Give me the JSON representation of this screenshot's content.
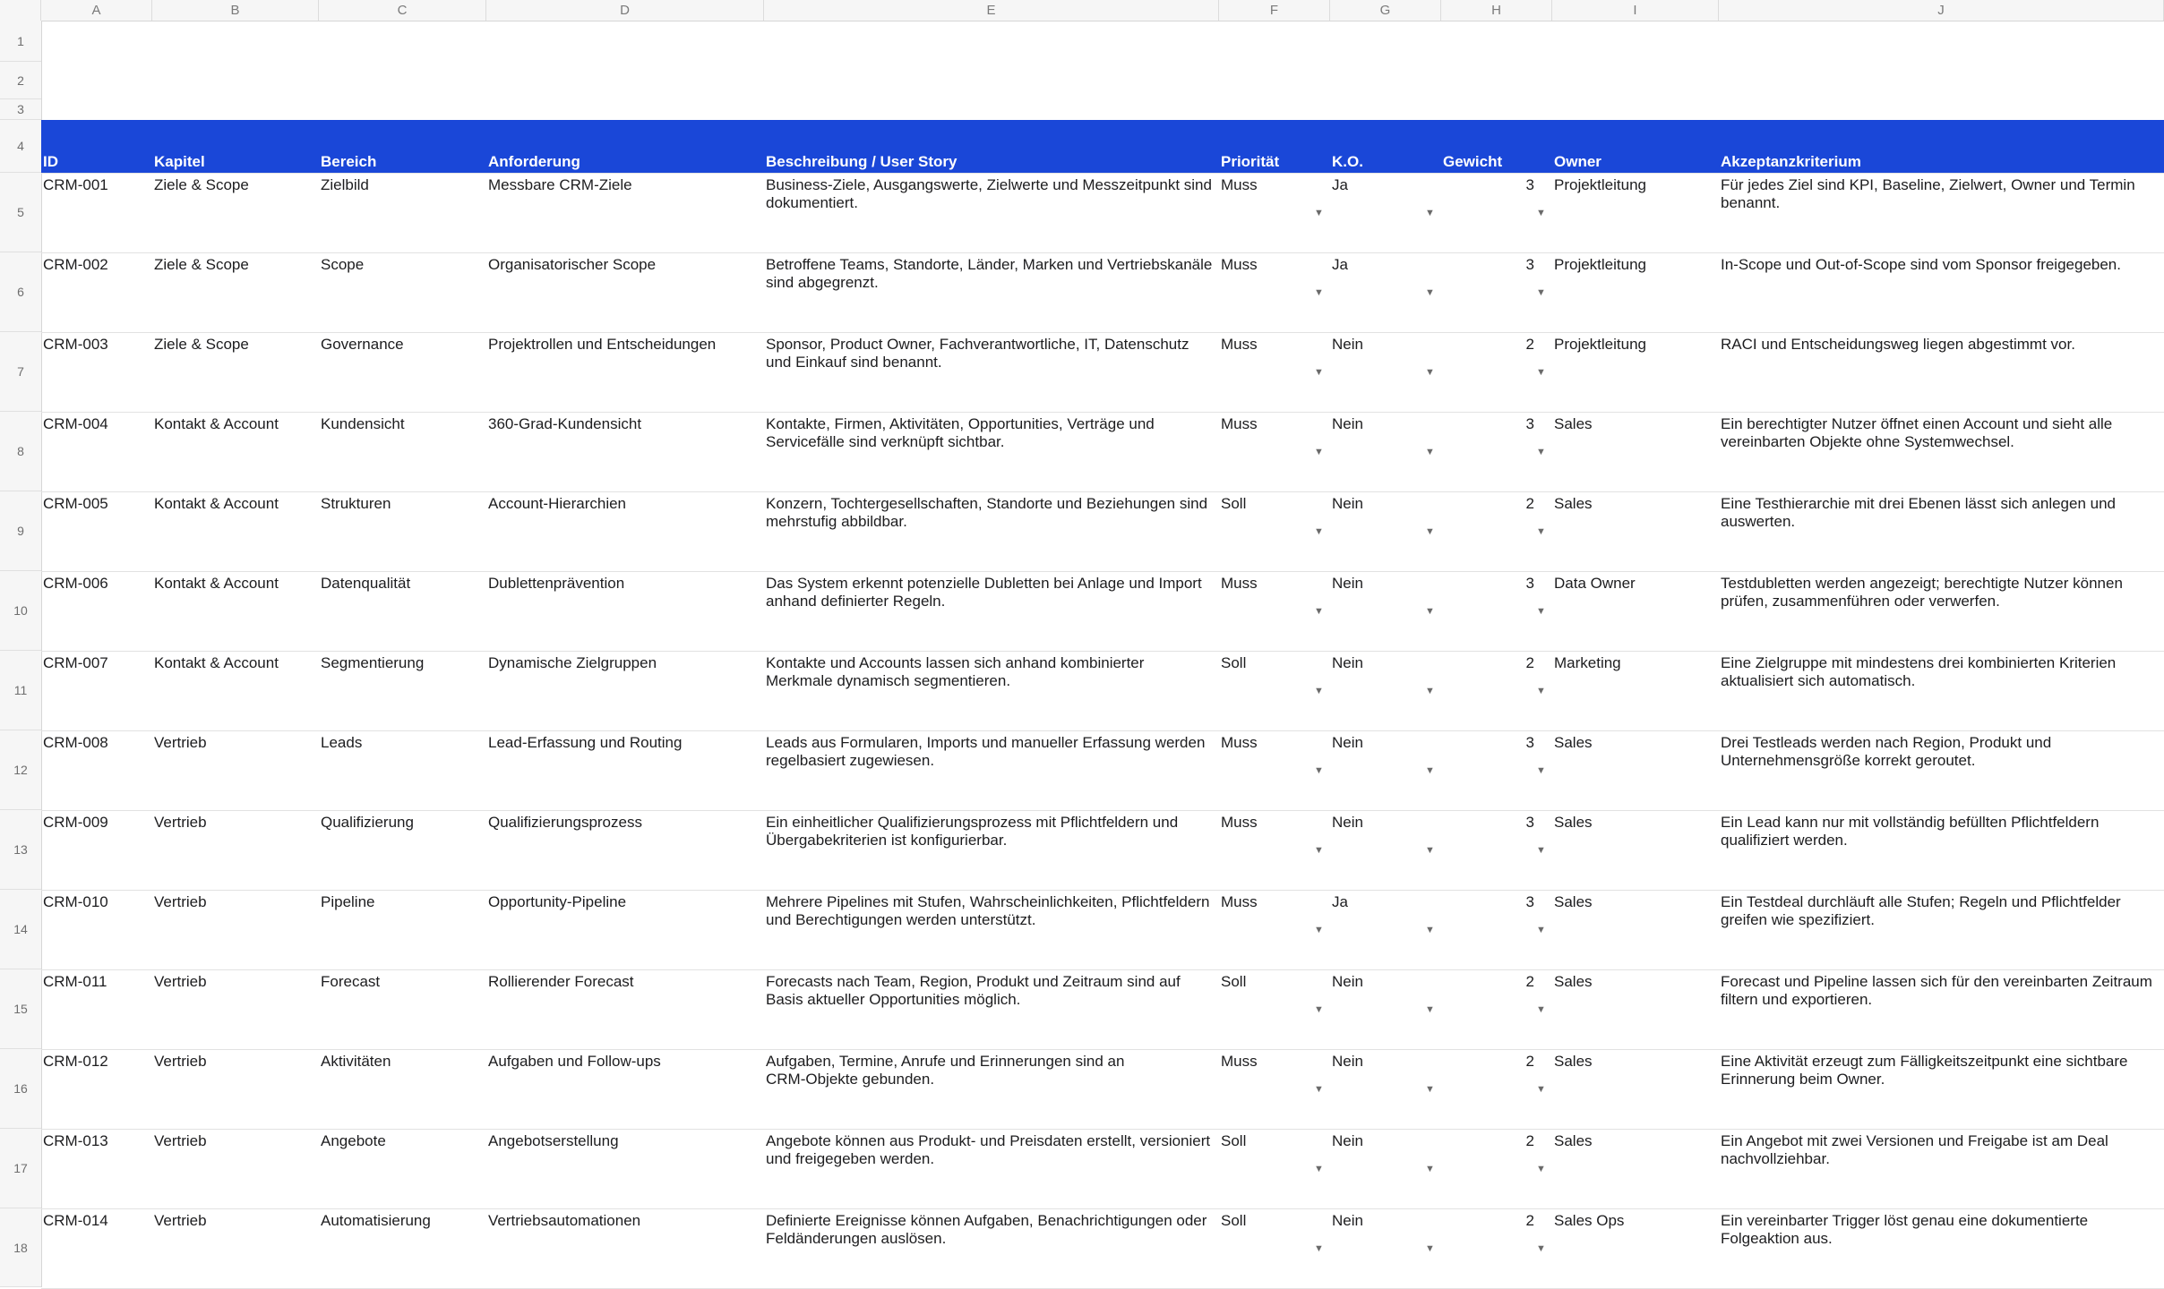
{
  "columns": [
    "A",
    "B",
    "C",
    "D",
    "E",
    "F",
    "G",
    "H",
    "I",
    "J"
  ],
  "row_numbers": [
    "1",
    "2",
    "3",
    "4",
    "5",
    "6",
    "7",
    "8",
    "9",
    "10",
    "11",
    "12",
    "13",
    "14",
    "15",
    "16",
    "17",
    "18"
  ],
  "header": {
    "id": "ID",
    "kapitel": "Kapitel",
    "bereich": "Bereich",
    "anforderung": "Anforderung",
    "beschreibung": "Beschreibung / User Story",
    "prioritaet": "Priorität",
    "ko": "K.O.",
    "gewicht": "Gewicht",
    "owner": "Owner",
    "akzeptanz": "Akzeptanzkriterium"
  },
  "header_color": "#1a47d8",
  "dropdown_icon": "chevron-down-icon",
  "rows": [
    {
      "id": "CRM-001",
      "kapitel": "Ziele & Scope",
      "bereich": "Zielbild",
      "anforderung": "Messbare CRM-Ziele",
      "beschreibung": [
        "Business-Ziele, Ausgangswerte, Zielwerte und Messzeitpunkt sind",
        "dokumentiert."
      ],
      "prioritaet": "Muss",
      "ko": "Ja",
      "gewicht": "3",
      "owner": "Projektleitung",
      "akzeptanz": [
        "Für jedes Ziel sind KPI, Baseline, Zielwert, Owner und Termin",
        "benannt."
      ]
    },
    {
      "id": "CRM-002",
      "kapitel": "Ziele & Scope",
      "bereich": "Scope",
      "anforderung": "Organisatorischer Scope",
      "beschreibung": [
        "Betroffene Teams, Standorte, Länder, Marken und Vertriebskanäle",
        "sind abgegrenzt."
      ],
      "prioritaet": "Muss",
      "ko": "Ja",
      "gewicht": "3",
      "owner": "Projektleitung",
      "akzeptanz": [
        "In-Scope und Out-of-Scope sind vom Sponsor freigegeben.",
        ""
      ]
    },
    {
      "id": "CRM-003",
      "kapitel": "Ziele & Scope",
      "bereich": "Governance",
      "anforderung": "Projektrollen und Entscheidungen",
      "beschreibung": [
        "Sponsor, Product Owner, Fachverantwortliche, IT, Datenschutz",
        "und Einkauf sind benannt."
      ],
      "prioritaet": "Muss",
      "ko": "Nein",
      "gewicht": "2",
      "owner": "Projektleitung",
      "akzeptanz": [
        "RACI und Entscheidungsweg liegen abgestimmt vor.",
        ""
      ]
    },
    {
      "id": "CRM-004",
      "kapitel": "Kontakt & Account",
      "bereich": "Kundensicht",
      "anforderung": "360-Grad-Kundensicht",
      "beschreibung": [
        "Kontakte, Firmen, Aktivitäten, Opportunities, Verträge und",
        "Servicefälle sind verknüpft sichtbar."
      ],
      "prioritaet": "Muss",
      "ko": "Nein",
      "gewicht": "3",
      "owner": "Sales",
      "akzeptanz": [
        "Ein berechtigter Nutzer öffnet einen Account und sieht alle",
        "vereinbarten Objekte ohne Systemwechsel."
      ]
    },
    {
      "id": "CRM-005",
      "kapitel": "Kontakt & Account",
      "bereich": "Strukturen",
      "anforderung": "Account-Hierarchien",
      "beschreibung": [
        "Konzern, Tochtergesellschaften, Standorte und Beziehungen sind",
        "mehrstufig abbildbar."
      ],
      "prioritaet": "Soll",
      "ko": "Nein",
      "gewicht": "2",
      "owner": "Sales",
      "akzeptanz": [
        "Eine Testhierarchie mit drei Ebenen lässt sich anlegen und",
        "auswerten."
      ]
    },
    {
      "id": "CRM-006",
      "kapitel": "Kontakt & Account",
      "bereich": "Datenqualität",
      "anforderung": "Dublettenprävention",
      "beschreibung": [
        "Das System erkennt potenzielle Dubletten bei Anlage und Import",
        "anhand definierter Regeln."
      ],
      "prioritaet": "Muss",
      "ko": "Nein",
      "gewicht": "3",
      "owner": "Data Owner",
      "akzeptanz": [
        "Testdubletten werden angezeigt; berechtigte Nutzer können",
        "prüfen, zusammenführen oder verwerfen."
      ]
    },
    {
      "id": "CRM-007",
      "kapitel": "Kontakt & Account",
      "bereich": "Segmentierung",
      "anforderung": "Dynamische Zielgruppen",
      "beschreibung": [
        "Kontakte und Accounts lassen sich anhand kombinierter",
        "Merkmale dynamisch segmentieren."
      ],
      "prioritaet": "Soll",
      "ko": "Nein",
      "gewicht": "2",
      "owner": "Marketing",
      "akzeptanz": [
        "Eine Zielgruppe mit mindestens drei kombinierten Kriterien",
        "aktualisiert sich automatisch."
      ]
    },
    {
      "id": "CRM-008",
      "kapitel": "Vertrieb",
      "bereich": "Leads",
      "anforderung": "Lead-Erfassung und Routing",
      "beschreibung": [
        "Leads aus Formularen, Imports und manueller Erfassung werden",
        "regelbasiert zugewiesen."
      ],
      "prioritaet": "Muss",
      "ko": "Nein",
      "gewicht": "3",
      "owner": "Sales",
      "akzeptanz": [
        "Drei Testleads werden nach Region, Produkt und",
        "Unternehmensgröße korrekt geroutet."
      ]
    },
    {
      "id": "CRM-009",
      "kapitel": "Vertrieb",
      "bereich": "Qualifizierung",
      "anforderung": "Qualifizierungsprozess",
      "beschreibung": [
        "Ein einheitlicher Qualifizierungsprozess mit Pflichtfeldern und",
        "Übergabekriterien ist konfigurierbar."
      ],
      "prioritaet": "Muss",
      "ko": "Nein",
      "gewicht": "3",
      "owner": "Sales",
      "akzeptanz": [
        "Ein Lead kann nur mit vollständig befüllten Pflichtfeldern",
        "qualifiziert werden."
      ]
    },
    {
      "id": "CRM-010",
      "kapitel": "Vertrieb",
      "bereich": "Pipeline",
      "anforderung": "Opportunity-Pipeline",
      "beschreibung": [
        "Mehrere Pipelines mit Stufen, Wahrscheinlichkeiten, Pflichtfeldern",
        "und Berechtigungen werden unterstützt."
      ],
      "prioritaet": "Muss",
      "ko": "Ja",
      "gewicht": "3",
      "owner": "Sales",
      "akzeptanz": [
        "Ein Testdeal durchläuft alle Stufen; Regeln und Pflichtfelder",
        "greifen wie spezifiziert."
      ]
    },
    {
      "id": "CRM-011",
      "kapitel": "Vertrieb",
      "bereich": "Forecast",
      "anforderung": "Rollierender Forecast",
      "beschreibung": [
        "Forecasts nach Team, Region, Produkt und Zeitraum sind auf",
        "Basis aktueller Opportunities möglich."
      ],
      "prioritaet": "Soll",
      "ko": "Nein",
      "gewicht": "2",
      "owner": "Sales",
      "akzeptanz": [
        "Forecast und Pipeline lassen sich für den vereinbarten Zeitraum",
        "filtern und exportieren."
      ]
    },
    {
      "id": "CRM-012",
      "kapitel": "Vertrieb",
      "bereich": "Aktivitäten",
      "anforderung": "Aufgaben und Follow-ups",
      "beschreibung": [
        "Aufgaben, Termine, Anrufe und Erinnerungen sind an",
        "CRM-Objekte gebunden."
      ],
      "prioritaet": "Muss",
      "ko": "Nein",
      "gewicht": "2",
      "owner": "Sales",
      "akzeptanz": [
        "Eine Aktivität erzeugt zum Fälligkeitszeitpunkt eine sichtbare",
        "Erinnerung beim Owner."
      ]
    },
    {
      "id": "CRM-013",
      "kapitel": "Vertrieb",
      "bereich": "Angebote",
      "anforderung": "Angebotserstellung",
      "beschreibung": [
        "Angebote können aus Produkt- und Preisdaten erstellt, versioniert",
        "und freigegeben werden."
      ],
      "prioritaet": "Soll",
      "ko": "Nein",
      "gewicht": "2",
      "owner": "Sales",
      "akzeptanz": [
        "Ein Angebot mit zwei Versionen und Freigabe ist am Deal",
        "nachvollziehbar."
      ]
    },
    {
      "id": "CRM-014",
      "kapitel": "Vertrieb",
      "bereich": "Automatisierung",
      "anforderung": "Vertriebsautomationen",
      "beschreibung": [
        "Definierte Ereignisse können Aufgaben, Benachrichtigungen oder",
        "Feldänderungen auslösen."
      ],
      "prioritaet": "Soll",
      "ko": "Nein",
      "gewicht": "2",
      "owner": "Sales Ops",
      "akzeptanz": [
        "Ein vereinbarter Trigger löst genau eine dokumentierte",
        "Folgeaktion aus."
      ]
    }
  ]
}
